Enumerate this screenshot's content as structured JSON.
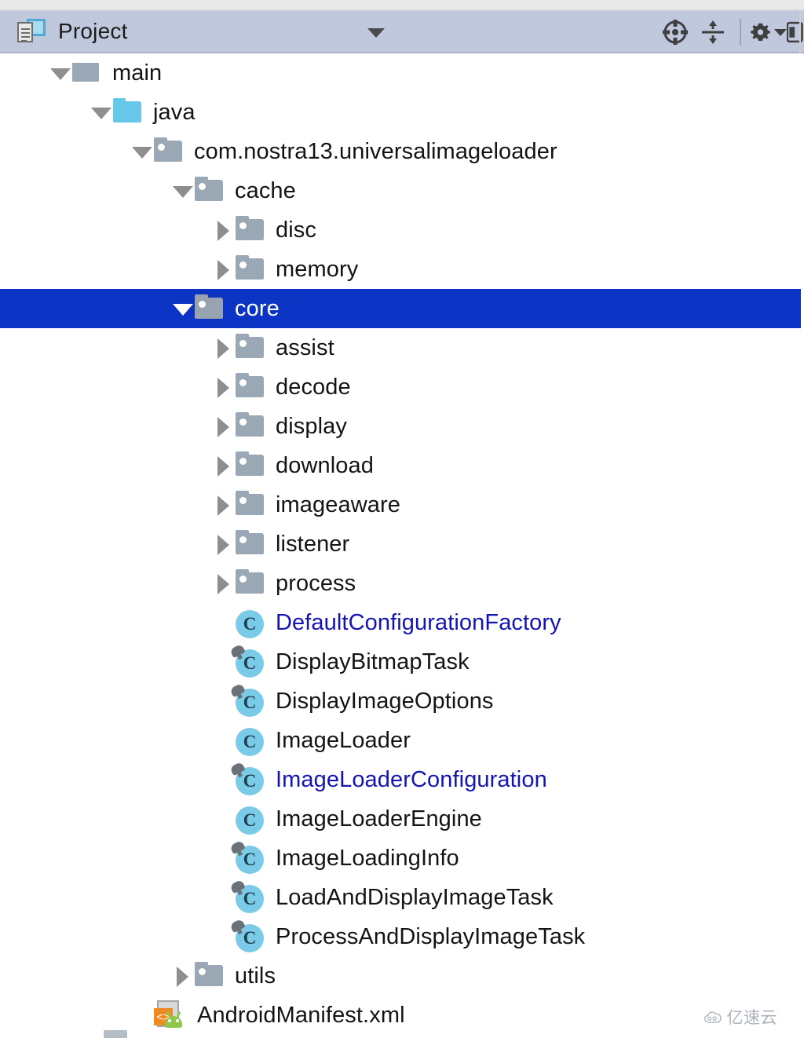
{
  "header": {
    "title": "Project",
    "icon": "project-window-icon",
    "dropdown_caret": "chevron-down-icon",
    "buttons": [
      {
        "name": "scroll-from-source-button",
        "icon": "crosshair-target-icon",
        "label": ""
      },
      {
        "name": "collapse-all-button",
        "icon": "collapse-all-icon",
        "label": ""
      },
      {
        "name": "settings-button",
        "icon": "gear-icon",
        "label": ""
      },
      {
        "name": "hide-button",
        "icon": "hide-panel-icon",
        "label": ""
      }
    ]
  },
  "colors": {
    "header_bg": "#bfc8dc",
    "selection_bg": "#0b33c4",
    "selection_fg": "#ffffff",
    "link_text": "#1414b4",
    "text": "#141414",
    "package_icon": "#9aa7b4",
    "java_folder_icon": "#67c7e8",
    "class_icon": "#79cbe8",
    "xml_accent": "#ef8a22",
    "android_green": "#8fc74a"
  },
  "tree": {
    "nodes": [
      {
        "label": "main",
        "indent": 1,
        "twisty": "open",
        "icon": "source-root-icon",
        "selected": false,
        "link": false
      },
      {
        "label": "java",
        "indent": 2,
        "twisty": "open",
        "icon": "java-folder-icon",
        "selected": false,
        "link": false
      },
      {
        "label": "com.nostra13.universalimageloader",
        "indent": 3,
        "twisty": "open",
        "icon": "package-icon",
        "selected": false,
        "link": false
      },
      {
        "label": "cache",
        "indent": 4,
        "twisty": "open",
        "icon": "package-icon",
        "selected": false,
        "link": false
      },
      {
        "label": "disc",
        "indent": 5,
        "twisty": "closed",
        "icon": "package-icon",
        "selected": false,
        "link": false
      },
      {
        "label": "memory",
        "indent": 5,
        "twisty": "closed",
        "icon": "package-icon",
        "selected": false,
        "link": false
      },
      {
        "label": "core",
        "indent": 4,
        "twisty": "open",
        "icon": "package-icon",
        "selected": true,
        "link": false
      },
      {
        "label": "assist",
        "indent": 5,
        "twisty": "closed",
        "icon": "package-icon",
        "selected": false,
        "link": false
      },
      {
        "label": "decode",
        "indent": 5,
        "twisty": "closed",
        "icon": "package-icon",
        "selected": false,
        "link": false
      },
      {
        "label": "display",
        "indent": 5,
        "twisty": "closed",
        "icon": "package-icon",
        "selected": false,
        "link": false
      },
      {
        "label": "download",
        "indent": 5,
        "twisty": "closed",
        "icon": "package-icon",
        "selected": false,
        "link": false
      },
      {
        "label": "imageaware",
        "indent": 5,
        "twisty": "closed",
        "icon": "package-icon",
        "selected": false,
        "link": false
      },
      {
        "label": "listener",
        "indent": 5,
        "twisty": "closed",
        "icon": "package-icon",
        "selected": false,
        "link": false
      },
      {
        "label": "process",
        "indent": 5,
        "twisty": "closed",
        "icon": "package-icon",
        "selected": false,
        "link": false
      },
      {
        "label": "DefaultConfigurationFactory",
        "indent": 5,
        "twisty": "none",
        "icon": "class-icon",
        "selected": false,
        "link": true,
        "badge": false
      },
      {
        "label": "DisplayBitmapTask",
        "indent": 5,
        "twisty": "none",
        "icon": "class-icon",
        "selected": false,
        "link": false,
        "badge": true
      },
      {
        "label": "DisplayImageOptions",
        "indent": 5,
        "twisty": "none",
        "icon": "class-icon",
        "selected": false,
        "link": false,
        "badge": true
      },
      {
        "label": "ImageLoader",
        "indent": 5,
        "twisty": "none",
        "icon": "class-icon",
        "selected": false,
        "link": false,
        "badge": false
      },
      {
        "label": "ImageLoaderConfiguration",
        "indent": 5,
        "twisty": "none",
        "icon": "class-icon",
        "selected": false,
        "link": true,
        "badge": true
      },
      {
        "label": "ImageLoaderEngine",
        "indent": 5,
        "twisty": "none",
        "icon": "class-icon",
        "selected": false,
        "link": false,
        "badge": false
      },
      {
        "label": "ImageLoadingInfo",
        "indent": 5,
        "twisty": "none",
        "icon": "class-icon",
        "selected": false,
        "link": false,
        "badge": true
      },
      {
        "label": "LoadAndDisplayImageTask",
        "indent": 5,
        "twisty": "none",
        "icon": "class-icon",
        "selected": false,
        "link": false,
        "badge": true
      },
      {
        "label": "ProcessAndDisplayImageTask",
        "indent": 5,
        "twisty": "none",
        "icon": "class-icon",
        "selected": false,
        "link": false,
        "badge": true
      },
      {
        "label": "utils",
        "indent": 4,
        "twisty": "closed",
        "icon": "package-icon",
        "selected": false,
        "link": false
      },
      {
        "label": "AndroidManifest.xml",
        "indent": 3,
        "twisty": "none",
        "icon": "android-xml-icon",
        "selected": false,
        "link": false
      }
    ]
  },
  "watermark": {
    "text": "亿速云",
    "icon": "cloud-icon"
  }
}
